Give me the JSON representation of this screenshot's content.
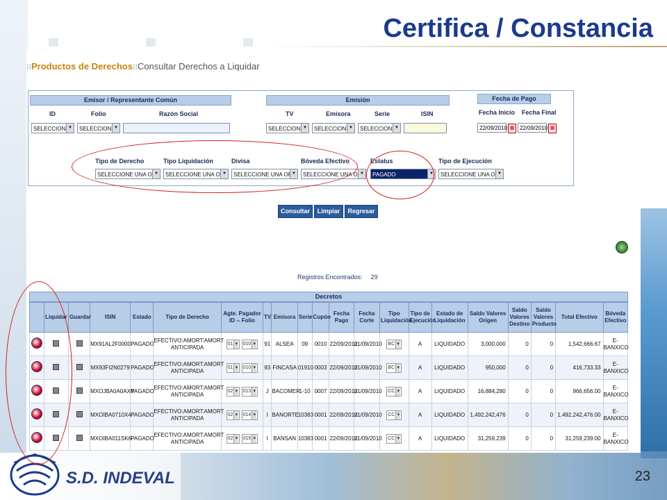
{
  "slide": {
    "title": "Certifica / Constancia",
    "brand": "S.D. INDEVAL",
    "page_number": "23"
  },
  "breadcrumb": {
    "section": "Productos de Derechos",
    "page": "Consultar Derechos a Liquidar"
  },
  "filters": {
    "emisor_group": "Emisor / Representante Común",
    "emision_group": "Emisión",
    "fecha_group": "Fecha de Pago",
    "id_label": "ID",
    "folio_label": "Folio",
    "razon_label": "Razón Social",
    "tv_label": "TV",
    "emisora_label": "Emisora",
    "serie_label": "Serie",
    "isin_label": "ISIN",
    "fecha_inicio_label": "Fecha Inicio",
    "fecha_final_label": "Fecha Final",
    "selecc": "SELECCIONE",
    "fecha_inicio": "22/09/2010",
    "fecha_final": "22/09/2010",
    "tipo_derecho_label": "Tipo de Derecho",
    "tipo_liq_label": "Tipo Liquidación",
    "divisa_label": "Divisa",
    "boveda_label": "Bóveda Efectivo",
    "estatus_label": "Estatus",
    "tipo_ejec_label": "Tipo de Ejecución",
    "selecc_una": "SELECCIONE UNA OP(",
    "estatus_value": "PAGADO"
  },
  "buttons": {
    "consultar": "Consultar",
    "limpiar": "Limpiar",
    "regresar": "Regresar"
  },
  "registros": {
    "label": "Registros Encontrados:",
    "count": "29"
  },
  "grid": {
    "title": "Decretos",
    "headers": [
      "",
      "Liquidar",
      "Guardar",
      "ISIN",
      "Estado",
      "Tipo de Derecho",
      "Agte. Pagador ID -- Folio",
      "TV",
      "Emisora",
      "Serie",
      "Cupón",
      "Fecha Pago",
      "Fecha Corte",
      "Tipo Liquidación",
      "Tipo de Ejecución",
      "Estado de Liquidación",
      "Saldo Valores Origen",
      "Saldo Valores Destino",
      "Saldo Valores Producto",
      "Total Efectivo",
      "Bóveda Efectivo"
    ],
    "rows": [
      {
        "isin": "MX91AL2F0000",
        "estado": "PAGADO",
        "tipo": "EFECTIVO:AMORT:AMORT ANTICIPADA",
        "agte_id": "01",
        "agte_folio": "010",
        "tv": "91",
        "emisora": "ALSEA",
        "serie": "09",
        "cupon": "0010",
        "fpago": "22/09/2010",
        "fcorte": "21/09/2010",
        "tliq": "BC",
        "tejec": "A",
        "eliq": "LIQUIDADO",
        "svo": "3,000,000",
        "svd": "0",
        "svp": "0",
        "total": "1,542,666.67",
        "boveda": "E-BANXICO"
      },
      {
        "isin": "MX93FI2N0279",
        "estado": "PAGADO",
        "tipo": "EFECTIVO:AMORT:AMORT ANTICIPADA",
        "agte_id": "01",
        "agte_folio": "010",
        "tv": "93",
        "emisora": "FINCASA",
        "serie": "01910",
        "cupon": "0003",
        "fpago": "22/09/2010",
        "fcorte": "21/09/2010",
        "tliq": "BC",
        "tejec": "A",
        "eliq": "LIQUIDADO",
        "svo": "950,000",
        "svd": "0",
        "svp": "0",
        "total": "416,733.33",
        "boveda": "E-BANXICO"
      },
      {
        "isin": "MXOJBA0A0AX9",
        "estado": "PAGADO",
        "tipo": "EFECTIVO:AMORT:AMORT ANTICIPADA",
        "agte_id": "02",
        "agte_folio": "013",
        "tv": "J",
        "emisora": "BACOMER",
        "serie": "1-10",
        "cupon": "0007",
        "fpago": "22/09/2010",
        "fcorte": "21/09/2010",
        "tliq": "CC",
        "tejec": "A",
        "eliq": "LIQUIDADO",
        "svo": "16,884,280",
        "svd": "0",
        "svp": "0",
        "total": "966,656.00",
        "boveda": "E-BANXICO"
      },
      {
        "isin": "MXOIBA0710X4",
        "estado": "PAGADO",
        "tipo": "EFECTIVO:AMORT:AMORT ANTICIPADA",
        "agte_id": "02",
        "agte_folio": "014",
        "tv": "I",
        "emisora": "BANORTE",
        "serie": "10383",
        "cupon": "0001",
        "fpago": "22/09/2010",
        "fcorte": "21/09/2010",
        "tliq": "CC",
        "tejec": "A",
        "eliq": "LIQUIDADO",
        "svo": "1,492,242,476",
        "svd": "0",
        "svp": "0",
        "total": "1,492,242,476.00",
        "boveda": "E-BANXICO"
      },
      {
        "isin": "MXOIBA011SK6",
        "estado": "PAGADO",
        "tipo": "EFECTIVO:AMORT:AMORT ANTICIPADA",
        "agte_id": "02",
        "agte_folio": "015",
        "tv": "I",
        "emisora": "BANSAN",
        "serie": "10383",
        "cupon": "0001",
        "fpago": "22/09/2010",
        "fcorte": "21/09/2010",
        "tliq": "CC",
        "tejec": "A",
        "eliq": "LIQUIDADO",
        "svo": "31,259,239",
        "svd": "0",
        "svp": "0",
        "total": "31,259,239.00",
        "boveda": "E-BANXICO"
      }
    ]
  }
}
